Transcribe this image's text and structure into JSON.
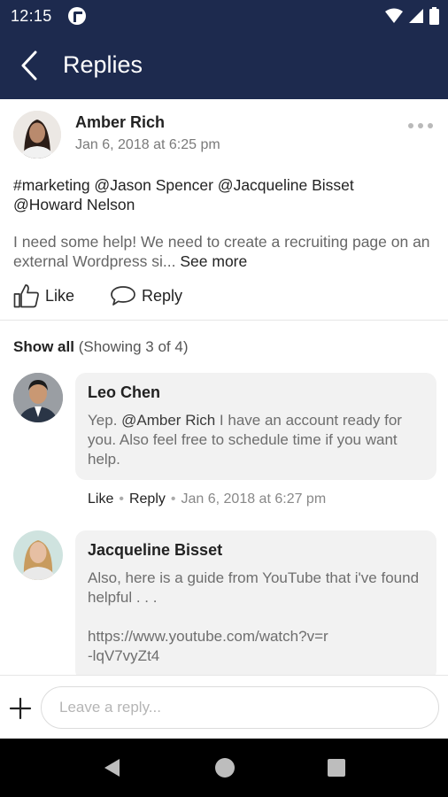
{
  "status_bar": {
    "time": "12:15"
  },
  "app_bar": {
    "title": "Replies"
  },
  "post": {
    "author": "Amber Rich",
    "timestamp": "Jan 6, 2018 at 6:25 pm",
    "tags_line1": "#marketing @Jason Spencer @Jacqueline Bisset",
    "tags_line2": "@Howard Nelson",
    "body": "I need some help! We need to create a recruiting page on an external Wordpress si...",
    "see_more": "See more",
    "like_label": "Like",
    "reply_label": "Reply"
  },
  "replies_header": {
    "show_all": "Show all",
    "count_text": "(Showing 3 of 4)"
  },
  "replies": [
    {
      "author": "Leo Chen",
      "text_prefix": "Yep. ",
      "mention": "@Amber Rich",
      "text_suffix": " I have an account ready for you.  Also feel free to schedule time if you want help.",
      "like": "Like",
      "reply": "Reply",
      "timestamp": "Jan 6, 2018 at 6:27 pm"
    },
    {
      "author": "Jacqueline Bisset",
      "text": "Also, here is a guide from YouTube that i've found helpful . . .\n\nhttps://www.youtube.com/watch?v=r\n-lqV7vyZt4"
    }
  ],
  "composer": {
    "placeholder": "Leave a reply..."
  },
  "colors": {
    "header": "#1d2a4e",
    "bubble": "#f2f2f2",
    "meta": "#888888"
  },
  "icons": {
    "status": [
      "app-notification-icon",
      "wifi-icon",
      "cellular-signal-icon",
      "battery-icon"
    ],
    "app_bar": "back-arrow-icon",
    "post": [
      "more-options-icon",
      "thumbs-up-icon",
      "speech-bubble-icon"
    ],
    "composer": "plus-icon",
    "navbar": [
      "nav-back-icon",
      "nav-home-icon",
      "nav-recents-icon"
    ]
  }
}
